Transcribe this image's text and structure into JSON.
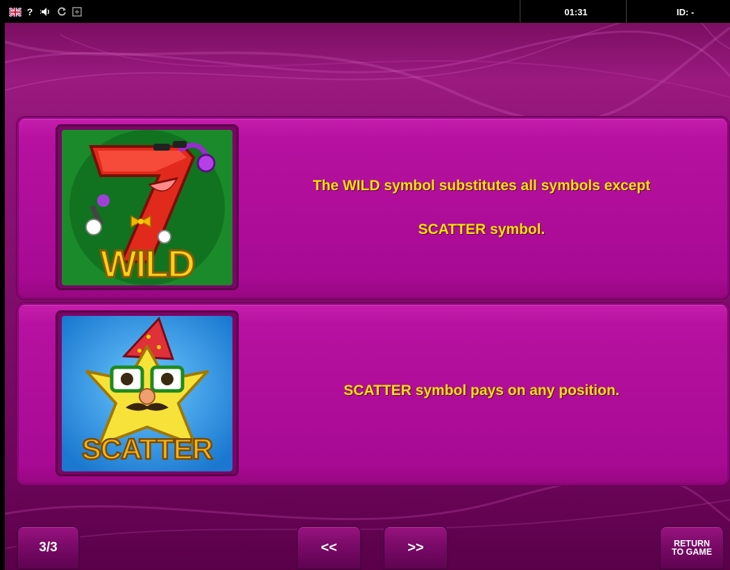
{
  "topbar": {
    "clock": "01:31",
    "id_label": "ID: -",
    "help_glyph": "?",
    "icons": [
      "uk-flag-icon",
      "help-icon",
      "sound-icon",
      "refresh-icon",
      "fullscreen-icon"
    ]
  },
  "symbols": {
    "wild": {
      "art_text": "WILD",
      "description_line1": "The WILD symbol substitutes all symbols except",
      "description_line2": "SCATTER symbol."
    },
    "scatter": {
      "art_text": "SCATTER",
      "description_line1": "SCATTER symbol pays on any position."
    }
  },
  "navigation": {
    "page_indicator": "3/3",
    "prev_label": "<<",
    "next_label": ">>",
    "return_line1": "RETURN",
    "return_line2": "TO GAME"
  },
  "colors": {
    "description_text": "#f2e400",
    "panel": "#b010a0",
    "wild_background": "#1a8a2a",
    "scatter_background": "#1a8fe0"
  }
}
